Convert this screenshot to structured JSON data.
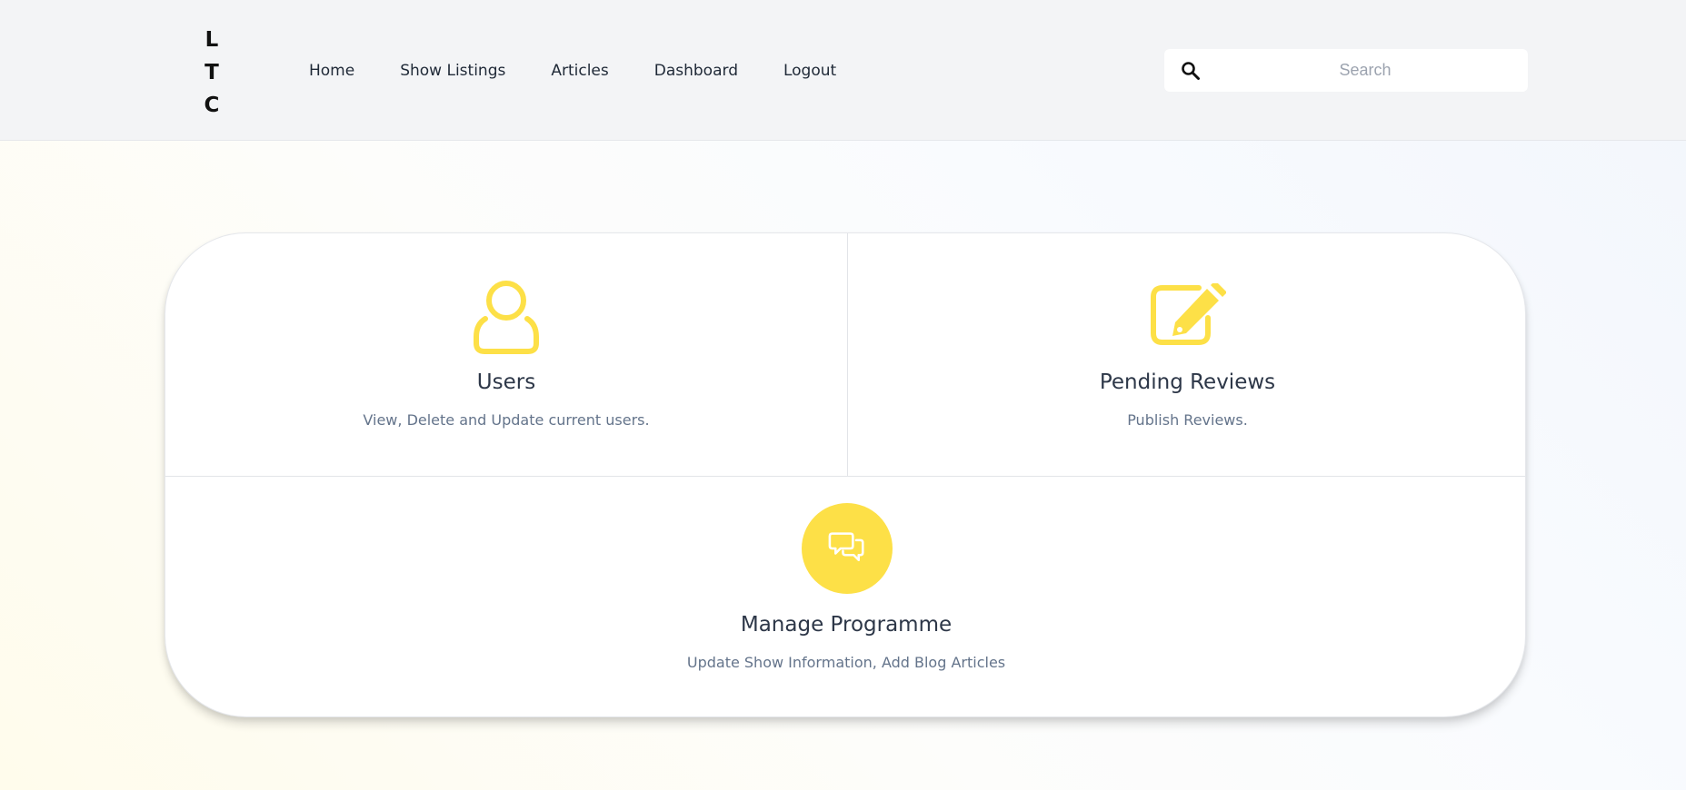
{
  "logo": {
    "letters": [
      "L",
      "T",
      "C"
    ]
  },
  "nav": {
    "items": [
      {
        "label": "Home"
      },
      {
        "label": "Show Listings"
      },
      {
        "label": "Articles"
      },
      {
        "label": "Dashboard"
      },
      {
        "label": "Logout"
      }
    ]
  },
  "search": {
    "placeholder": "Search",
    "value": "",
    "icon": "search-icon"
  },
  "cards": {
    "users": {
      "title": "Users",
      "description": "View, Delete and Update current users.",
      "icon": "user-icon"
    },
    "reviews": {
      "title": "Pending Reviews",
      "description": "Publish Reviews.",
      "icon": "edit-icon"
    },
    "programme": {
      "title": "Manage Programme",
      "description": "Update Show Information, Add Blog Articles",
      "icon": "chat-bubbles-icon"
    }
  },
  "colors": {
    "accent": "#fde047",
    "header_bg": "#f3f4f6",
    "title_text": "#2d3748",
    "muted_text": "#64748b"
  }
}
